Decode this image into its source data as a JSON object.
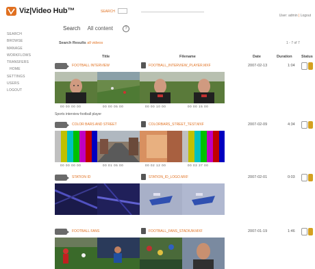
{
  "app": {
    "logo_text": "Viz|Video Hub™"
  },
  "header": {
    "search_label": "SEARCH",
    "search_value": "",
    "user_label": "User: admin",
    "separator": "|",
    "logout_label": "Logout"
  },
  "sidebar": {
    "items": [
      {
        "label": "Search",
        "sub": false
      },
      {
        "label": "Browse",
        "sub": false
      },
      {
        "label": "Manage",
        "sub": false
      },
      {
        "label": "Workflows",
        "sub": false
      },
      {
        "label": "Transfers",
        "sub": false
      },
      {
        "label": "Home",
        "sub": true
      },
      {
        "label": "Settings",
        "sub": false
      },
      {
        "label": "Users",
        "sub": false
      },
      {
        "label": "Logout",
        "sub": false
      }
    ]
  },
  "search": {
    "label": "Search",
    "scope": "All content",
    "help": "?"
  },
  "results": {
    "title": "Search Results",
    "filter": "all videos",
    "pager": "1 - 7 of 7"
  },
  "columns": {
    "title": "Title",
    "filename": "Filename",
    "date": "Date",
    "duration": "Duration",
    "status": "Status"
  },
  "rows": [
    {
      "title": "FOOTBALL INTERVIEW",
      "filename": "FOOTBALL_INTERVIEW_PLAYER.MXF",
      "date": "2007-02-13",
      "duration": "1:04",
      "timecodes": [
        "00 00 00 00",
        "00 00 05 00",
        "00 00 10 00",
        "00 00 15 00"
      ],
      "description": "Sports interview football player"
    },
    {
      "title": "COLOR BARS AND STREET",
      "filename": "COLORBARS_STREET_TEST.MXF",
      "date": "2007-02-09",
      "duration": "4:34",
      "timecodes": [
        "00 00 00 00",
        "00 01 05 00",
        "00 02 12 00",
        "00 03 37 00"
      ],
      "description": ""
    },
    {
      "title": "STATION ID",
      "filename": "STATION_ID_LOGO.MXF",
      "date": "2007-02-01",
      "duration": "0:03",
      "timecodes": [],
      "description": ""
    },
    {
      "title": "FOOTBALL FANS",
      "filename": "FOOTBALL_FANS_STADIUM.MXF",
      "date": "2007-01-19",
      "duration": "1:46",
      "timecodes": [],
      "description": ""
    }
  ],
  "colors": {
    "accent": "#e07020",
    "status_chip": "#d4a020"
  }
}
